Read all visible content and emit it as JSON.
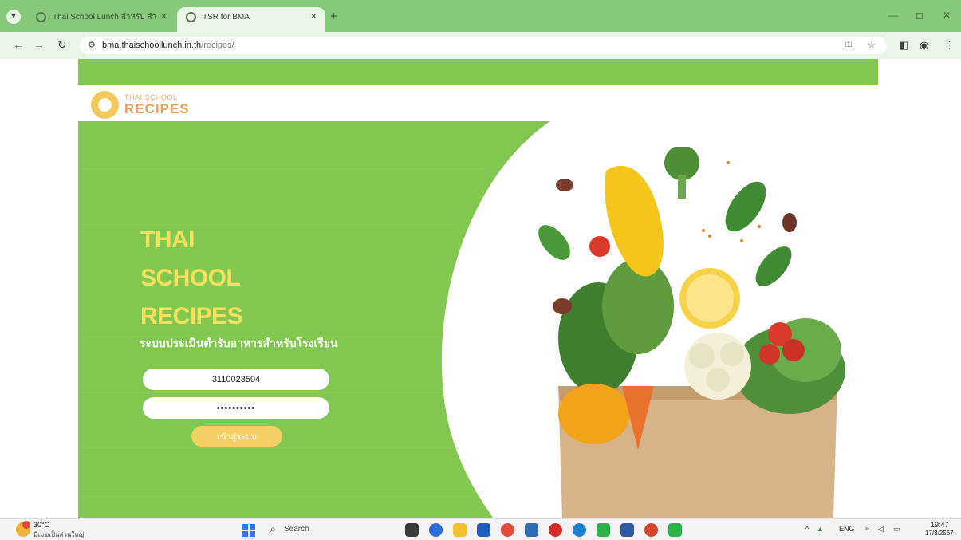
{
  "browser": {
    "tabs": [
      {
        "label": "Thai School Lunch สำหรับ สำนัก",
        "active": false
      },
      {
        "label": "TSR for BMA",
        "active": true
      }
    ],
    "url": {
      "domain": "bma.thaischoollunch.in.th",
      "path": "/recipes/"
    }
  },
  "logo": {
    "top_text": "THAI SCHOOL",
    "bottom_text": "RECIPES"
  },
  "hero": {
    "title_line1": "THAI",
    "title_line2": "SCHOOL",
    "title_line3": "RECIPES",
    "subtitle": "ระบบประเมินตำรับอาหารสำหรับโรงเรียน"
  },
  "login": {
    "username_value": "3110023504",
    "password_value": "••••••••••",
    "submit_label": "เข้าสู่ระบบ"
  },
  "taskbar": {
    "weather_temp": "30°C",
    "weather_desc": "มีเมฆเป็นส่วนใหญ่",
    "search_label": "Search",
    "language": "ENG",
    "time": "19:47",
    "date": "17/3/2567"
  },
  "colors": {
    "hero_green": "#82c850",
    "title_yellow": "#f7e05e",
    "button_yellow": "#f6cf64",
    "logo_orange": "#e79e61",
    "chrome_green": "#86c97a"
  }
}
